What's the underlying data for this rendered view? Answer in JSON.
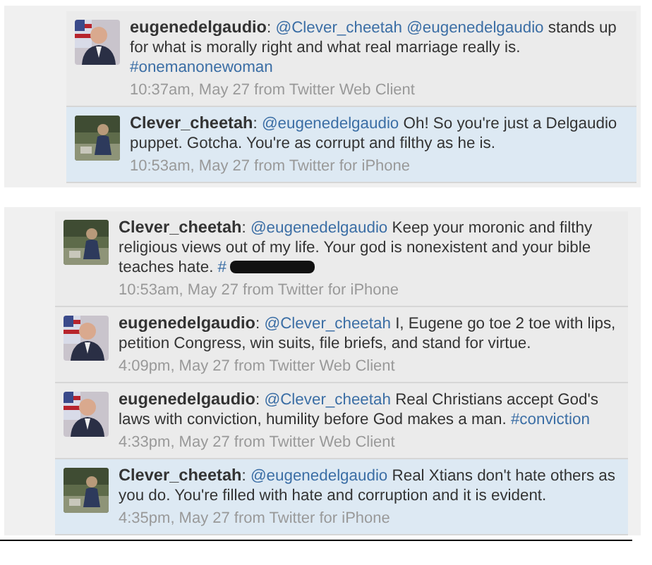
{
  "panels": [
    {
      "tweets": [
        {
          "author": "eugenedelgaudio",
          "highlighted": false,
          "segments": [
            {
              "kind": "text",
              "text": ":"
            },
            {
              "kind": "mention",
              "text": "@Clever_cheetah"
            },
            {
              "kind": "mention",
              "text": "@eugenedelgaudio"
            },
            {
              "kind": "text",
              "text": "stands up for what is morally right and what real marriage really is."
            },
            {
              "kind": "hashtag",
              "text": "#onemanonewoman"
            }
          ],
          "meta": "10:37am, May 27 from Twitter Web Client"
        },
        {
          "author": "Clever_cheetah",
          "highlighted": true,
          "segments": [
            {
              "kind": "text",
              "text": ":"
            },
            {
              "kind": "mention",
              "text": "@eugenedelgaudio"
            },
            {
              "kind": "text",
              "text": "Oh! So you're just a Delgaudio puppet. Gotcha. You're as corrupt and filthy as he is."
            }
          ],
          "meta": "10:53am, May 27 from Twitter for iPhone"
        }
      ]
    },
    {
      "tweets": [
        {
          "author": "Clever_cheetah",
          "highlighted": false,
          "segments": [
            {
              "kind": "text",
              "text": ":"
            },
            {
              "kind": "mention",
              "text": "@eugenedelgaudio"
            },
            {
              "kind": "text",
              "text": "Keep your moronic and filthy religious views out of my life. Your god is nonexistent and your bible teaches hate."
            },
            {
              "kind": "hashtag",
              "text": "#"
            },
            {
              "kind": "redaction"
            }
          ],
          "meta": "10:53am, May 27 from Twitter for iPhone"
        },
        {
          "author": "eugenedelgaudio",
          "highlighted": false,
          "segments": [
            {
              "kind": "text",
              "text": ":"
            },
            {
              "kind": "mention",
              "text": "@Clever_cheetah"
            },
            {
              "kind": "text",
              "text": "I, Eugene go toe 2 toe with lips, petition Congress, win suits, file briefs, and stand for virtue."
            }
          ],
          "meta": "4:09pm, May 27 from Twitter Web Client"
        },
        {
          "author": "eugenedelgaudio",
          "highlighted": false,
          "segments": [
            {
              "kind": "text",
              "text": ":"
            },
            {
              "kind": "mention",
              "text": "@Clever_cheetah"
            },
            {
              "kind": "text",
              "text": "Real Christians accept God's laws with conviction, humility before God makes a man."
            },
            {
              "kind": "hashtag",
              "text": "#conviction"
            }
          ],
          "meta": "4:33pm, May 27 from Twitter Web Client"
        },
        {
          "author": "Clever_cheetah",
          "highlighted": true,
          "segments": [
            {
              "kind": "text",
              "text": ":"
            },
            {
              "kind": "mention",
              "text": "@eugenedelgaudio"
            },
            {
              "kind": "text",
              "text": "Real Xtians don't hate others as you do. You're filled with hate and corruption and it is evident."
            }
          ],
          "meta": "4:35pm, May 27 from Twitter for iPhone"
        }
      ]
    }
  ]
}
